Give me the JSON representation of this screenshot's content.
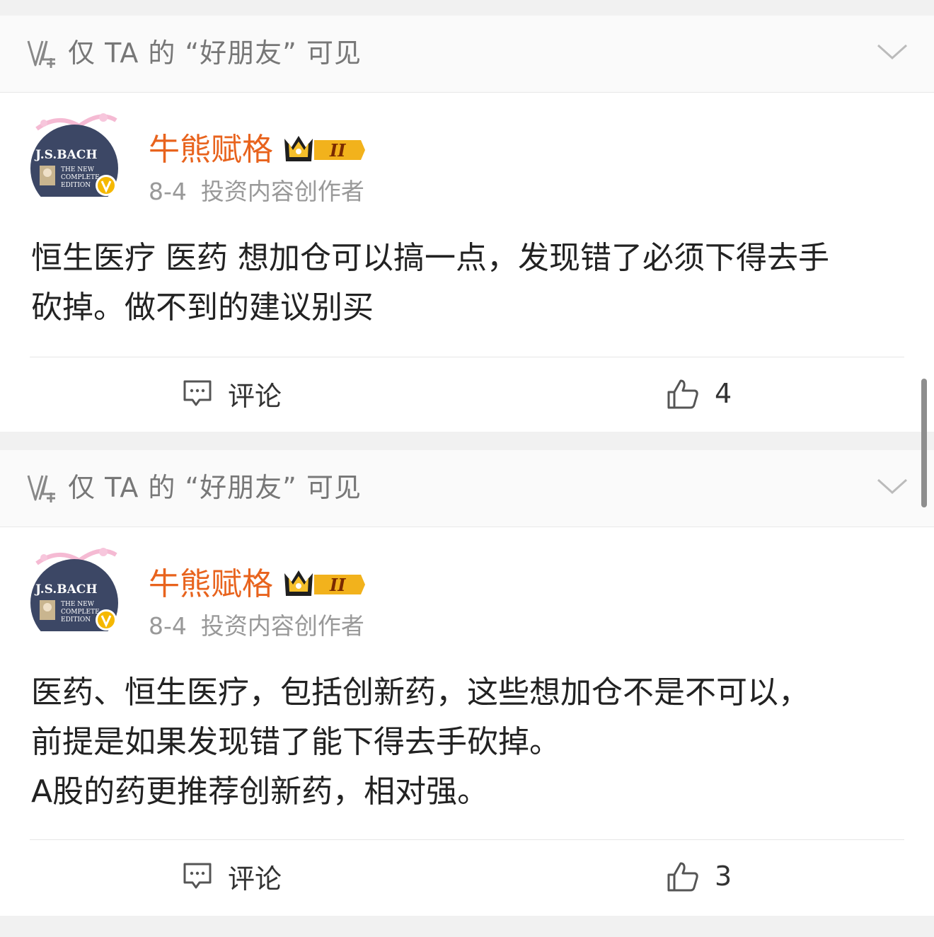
{
  "posts": [
    {
      "visibility": "仅 TA 的 “好朋友” 可见",
      "avatar_text": {
        "line1": "J.S.BACH",
        "line2": "THE NEW",
        "line3": "COMPLETE",
        "line4": "EDITION"
      },
      "username": "牛熊赋格",
      "vip_level": "II",
      "date": "8-4",
      "role": "投资内容创作者",
      "content_lines": [
        "恒生医疗 医药 想加仓可以搞一点，发现错了必须下得去手",
        "砍掉。做不到的建议别买"
      ],
      "comment_label": "评论",
      "like_count": "4"
    },
    {
      "visibility": "仅 TA 的 “好朋友” 可见",
      "avatar_text": {
        "line1": "J.S.BACH",
        "line2": "THE NEW",
        "line3": "COMPLETE",
        "line4": "EDITION"
      },
      "username": "牛熊赋格",
      "vip_level": "II",
      "date": "8-4",
      "role": "投资内容创作者",
      "content_lines": [
        "医药、恒生医疗，包括创新药，这些想加仓不是不可以，",
        "前提是如果发现错了能下得去手砍掉。",
        "A股的药更推荐创新药，相对强。"
      ],
      "comment_label": "评论",
      "like_count": "3"
    }
  ],
  "colors": {
    "username": "#e8631d",
    "verified_badge": "#f5b800",
    "text_primary": "#222222",
    "text_secondary": "#999999",
    "page_background": "#f1f1f1"
  }
}
